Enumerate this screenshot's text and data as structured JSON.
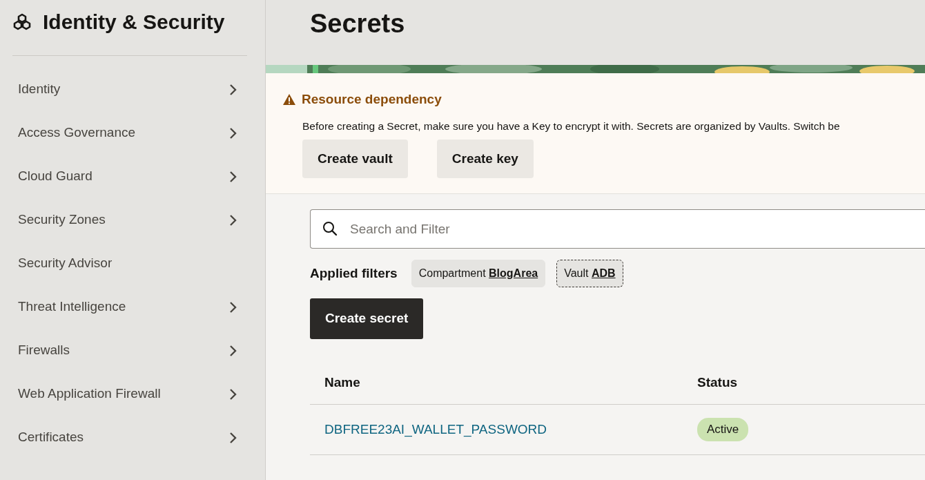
{
  "sidebar": {
    "title": "Identity & Security",
    "items": [
      {
        "label": "Identity",
        "expandable": true
      },
      {
        "label": "Access Governance",
        "expandable": true
      },
      {
        "label": "Cloud Guard",
        "expandable": true
      },
      {
        "label": "Security Zones",
        "expandable": true
      },
      {
        "label": "Security Advisor",
        "expandable": false
      },
      {
        "label": "Threat Intelligence",
        "expandable": true
      },
      {
        "label": "Firewalls",
        "expandable": true
      },
      {
        "label": "Web Application Firewall",
        "expandable": true
      },
      {
        "label": "Certificates",
        "expandable": true
      }
    ]
  },
  "page": {
    "title": "Secrets"
  },
  "alert": {
    "title": "Resource dependency",
    "message": "Before creating a Secret, make sure you have a Key to encrypt it with. Secrets are organized by Vaults. Switch be",
    "buttons": [
      "Create vault",
      "Create key"
    ]
  },
  "search": {
    "placeholder": "Search and Filter"
  },
  "filters": {
    "label": "Applied filters",
    "chips": [
      {
        "name": "Compartment",
        "value": "BlogArea",
        "focused": false
      },
      {
        "name": "Vault",
        "value": "ADB",
        "focused": true
      }
    ]
  },
  "create_button": "Create secret",
  "table": {
    "columns": [
      "Name",
      "Status"
    ],
    "rows": [
      {
        "name": "DBFREE23AI_WALLET_PASSWORD",
        "status": "Active"
      }
    ]
  }
}
